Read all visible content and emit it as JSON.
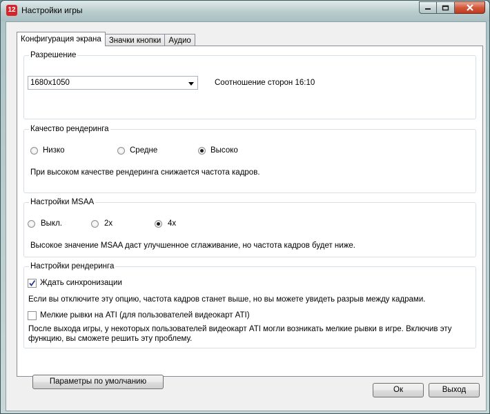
{
  "window": {
    "title": "Настройки игры",
    "icon_text": "12"
  },
  "tabs": [
    {
      "label": "Конфигурация экрана"
    },
    {
      "label": "Значки кнопки"
    },
    {
      "label": "Аудио"
    }
  ],
  "resolution": {
    "title": "Разрешение",
    "value": "1680x1050",
    "aspect": "Соотношение сторон 16:10"
  },
  "quality": {
    "title": "Качество рендеринга",
    "options": [
      "Низко",
      "Средне",
      "Высоко"
    ],
    "selected": "Высоко",
    "note": "При высоком качестве рендеринга снижается частота кадров."
  },
  "msaa": {
    "title": "Настройки MSAA",
    "options": [
      "Выкл.",
      "2x",
      "4x"
    ],
    "selected": "4x",
    "note": "Высокое значение MSAA даст улучшенное сглаживание, но частота кадров будет ниже."
  },
  "render": {
    "title": "Настройки рендеринга",
    "vsync_label": "Ждать синхронизации",
    "vsync_checked": true,
    "vsync_note": "Если вы отключите эту опцию, частота кадров станет выше, но вы можете увидеть разрыв между кадрами.",
    "ati_label": "Мелкие рывки на ATI (для пользователей видеокарт ATI)",
    "ati_checked": false,
    "ati_note_1": "После выхода игры, у некоторых пользователей видеокарт ATI могли возникать мелкие рывки в игре. Включив эту",
    "ati_note_2": "функцию, вы сможете решить эту проблему."
  },
  "buttons": {
    "defaults": "Параметры по умолчанию",
    "ok": "Ок",
    "exit": "Выход"
  }
}
